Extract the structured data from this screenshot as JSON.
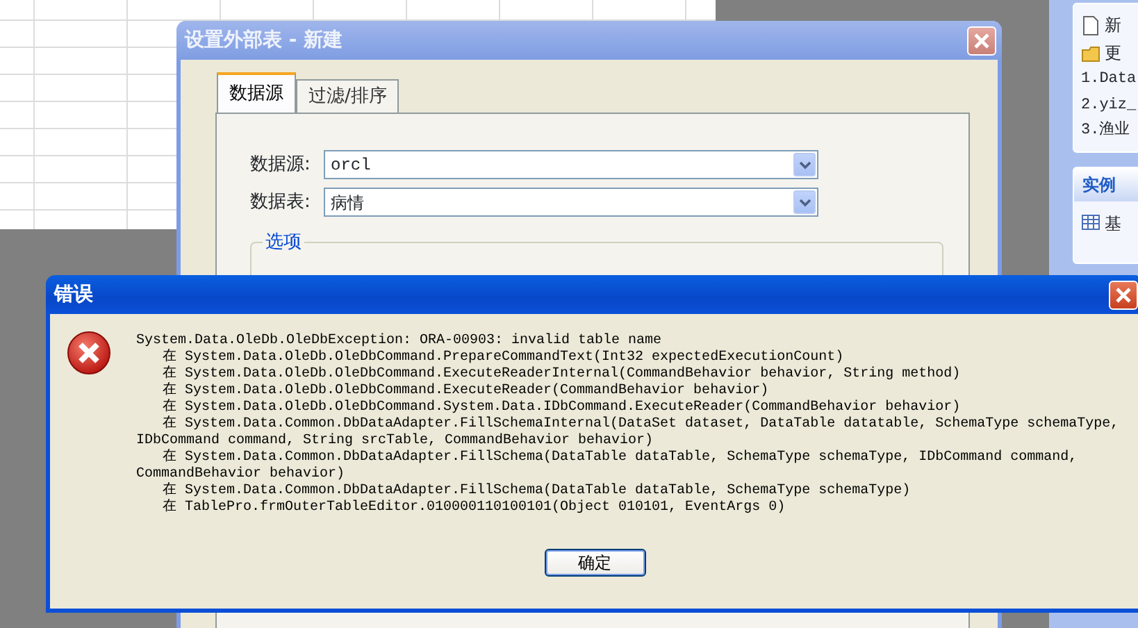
{
  "task_pane": {
    "sections": [
      {
        "items": [
          {
            "kind": "new",
            "label": "新"
          },
          {
            "kind": "open",
            "label": "更"
          },
          {
            "kind": "recent",
            "label": "1.Data"
          },
          {
            "kind": "recent",
            "label": "2.yiz_"
          },
          {
            "kind": "recent",
            "label": "3.渔业"
          }
        ]
      },
      {
        "heading": "实例",
        "items": [
          {
            "kind": "table",
            "label": "基"
          }
        ]
      }
    ]
  },
  "editor_dialog": {
    "title": "设置外部表 - 新建",
    "tabs": [
      {
        "label": "数据源",
        "selected": true
      },
      {
        "label": "过滤/排序",
        "selected": false
      }
    ],
    "fields": [
      {
        "label": "数据源:",
        "value": "orcl"
      },
      {
        "label": "数据表:",
        "value": "病情"
      }
    ],
    "group": {
      "title": "选项"
    }
  },
  "error_dialog": {
    "title": "错误",
    "message_lines": [
      {
        "kind": "head",
        "text": "System.Data.OleDb.OleDbException: ORA-00903: invalid table name"
      },
      {
        "kind": "frame",
        "text": "在 System.Data.OleDb.OleDbCommand.PrepareCommandText(Int32 expectedExecutionCount)"
      },
      {
        "kind": "frame",
        "text": "在 System.Data.OleDb.OleDbCommand.ExecuteReaderInternal(CommandBehavior behavior, String method)"
      },
      {
        "kind": "frame",
        "text": "在 System.Data.OleDb.OleDbCommand.ExecuteReader(CommandBehavior behavior)"
      },
      {
        "kind": "frame",
        "text": "在 System.Data.OleDb.OleDbCommand.System.Data.IDbCommand.ExecuteReader(CommandBehavior behavior)"
      },
      {
        "kind": "frame",
        "text": "在 System.Data.Common.DbDataAdapter.FillSchemaInternal(DataSet dataset, DataTable datatable, SchemaType schemaType,"
      },
      {
        "kind": "continuation",
        "text": "IDbCommand command, String srcTable, CommandBehavior behavior)"
      },
      {
        "kind": "frame",
        "text": "在 System.Data.Common.DbDataAdapter.FillSchema(DataTable dataTable, SchemaType schemaType, IDbCommand command,"
      },
      {
        "kind": "continuation",
        "text": "CommandBehavior behavior)"
      },
      {
        "kind": "frame",
        "text": "在 System.Data.Common.DbDataAdapter.FillSchema(DataTable dataTable, SchemaType schemaType)"
      },
      {
        "kind": "frame",
        "text": "在 TablePro.frmOuterTableEditor.010000110100101(Object 010101, EventArgs 0)"
      }
    ],
    "button": "确定"
  }
}
